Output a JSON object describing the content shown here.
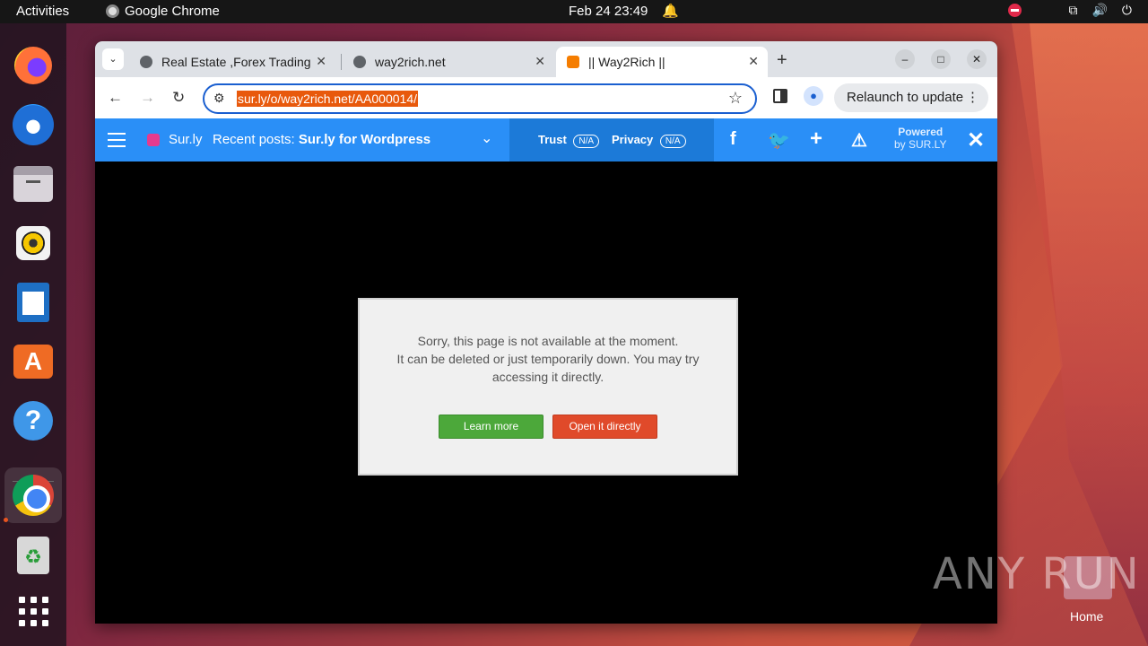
{
  "topbar": {
    "activities": "Activities",
    "app_name": "Google Chrome",
    "clock": "Feb 24  23:49"
  },
  "browser": {
    "tabs": [
      {
        "title": "Real Estate ,Forex Trading",
        "favicon": "globe-icon",
        "active": false
      },
      {
        "title": "way2rich.net",
        "favicon": "globe-icon",
        "active": false
      },
      {
        "title": "|| Way2Rich ||",
        "favicon": "blogger-icon",
        "active": true
      }
    ],
    "url": "sur.ly/o/way2rich.net/AA000014/",
    "relaunch_label": "Relaunch to update"
  },
  "surly_bar": {
    "brand": "Sur.ly",
    "recent_prefix": "Recent posts:",
    "recent_title": "Sur.ly for Wordpress",
    "trust_label": "Trust",
    "trust_value": "N/A",
    "privacy_label": "Privacy",
    "privacy_value": "N/A",
    "powered_line1": "Powered",
    "powered_line2": "by SUR.LY",
    "colors": {
      "bar": "#2a8ff7",
      "mid": "#1c7ad8"
    }
  },
  "dialog": {
    "line1": "Sorry, this page is not available at the moment.",
    "line2": "It can be deleted or just temporarily down. You may try",
    "line3": "accessing it directly.",
    "learn_more": "Learn more",
    "open_directly": "Open it directly",
    "colors": {
      "learn": "#4ca83a",
      "open": "#e04a2a"
    }
  },
  "desktop": {
    "watermark": "ANY RUN",
    "home_label": "Home"
  }
}
